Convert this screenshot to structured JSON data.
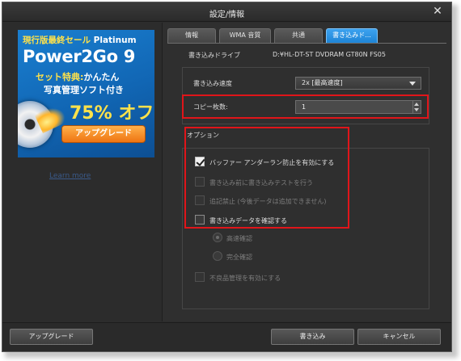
{
  "window": {
    "title": "設定/情報"
  },
  "ad": {
    "line1a": "現行版最終セール",
    "line1b": "Platinum",
    "brand": "Power2Go 9",
    "line2a": "セット特典:",
    "line2b": "かんたん",
    "line3": "写真管理ソフト付き",
    "percent": "75% オフ",
    "button": "アップグレード",
    "link": "Learn more"
  },
  "tabs": [
    {
      "label": "情報",
      "active": false
    },
    {
      "label": "WMA 音質",
      "active": false
    },
    {
      "label": "共通",
      "active": false
    },
    {
      "label": "書き込みド...",
      "active": true
    }
  ],
  "drive": {
    "label": "書き込みドライブ",
    "value": "D:¥HL-DT-ST DVDRAM GT80N FS05"
  },
  "write_speed": {
    "label": "書き込み速度",
    "value": "2x [最高速度]"
  },
  "copies": {
    "label": "コピー枚数:",
    "value": "1"
  },
  "options": {
    "title": "オプション",
    "buffer_underrun": {
      "label": "バッファー アンダーラン防止を有効にする",
      "checked": true,
      "enabled": true
    },
    "test_write": {
      "label": "書き込み前に書き込みテストを行う",
      "checked": false,
      "enabled": false
    },
    "no_append": {
      "label": "追記禁止 (今後データは追加できません)",
      "checked": false,
      "enabled": false
    },
    "verify": {
      "label": "書き込みデータを確認する",
      "checked": false,
      "enabled": true
    },
    "fast_verify": {
      "label": "高速確認",
      "selected": true,
      "enabled": false
    },
    "full_verify": {
      "label": "完全確認",
      "selected": false,
      "enabled": false
    },
    "defect_mgmt": {
      "label": "不良品管理を有効にする",
      "checked": false,
      "enabled": false
    }
  },
  "buttons": {
    "upgrade": "アップグレード",
    "burn": "書き込み",
    "cancel": "キャンセル"
  },
  "colors": {
    "tab_active": "#2a90e0",
    "highlight_box": "#e0151a",
    "ad_background": "#1570c4"
  }
}
